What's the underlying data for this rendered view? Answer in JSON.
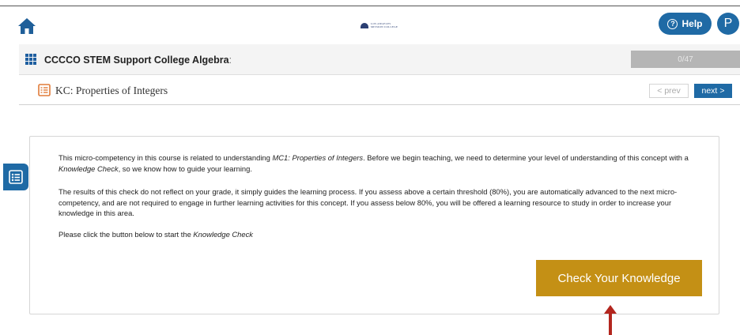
{
  "header": {
    "logo_lines": [
      "LOS ANGELES",
      "MISSION COLLEGE"
    ],
    "help_label": "Help",
    "help_glyph": "?",
    "avatar_initial": "P",
    "accent_color": "#1f6aa5"
  },
  "course": {
    "title": "CCCCO STEM Support College Algebra",
    "title_suffix": ":",
    "progress": "0/47"
  },
  "lesson": {
    "title": "KC: Properties of Integers",
    "prev_label": "prev",
    "next_label": "next"
  },
  "content": {
    "p1": {
      "a": "This micro-competency in this course is related to understanding ",
      "b": "MC1: Properties of Integers",
      "c": ". Before we begin teaching, we need to determine your level of understanding of this concept with a ",
      "d": "Knowledge Check",
      "e": ", so we know how to guide your learning."
    },
    "p2": "The results of this check do not reflect on your grade, it simply guides the learning process. If you assess above a certain threshold (80%), you are automatically advanced to the next micro-competency, and are not required to engage in further learning activities for this concept. If you assess below 80%, you will be offered a learning resource to study in order to increase your knowledge in this area.",
    "p3": {
      "a": "Please click the button below to start the ",
      "b": "Knowledge Check"
    },
    "button_label": "Check Your Knowledge",
    "button_color": "#c49015"
  },
  "annotation": {
    "arrow_color": "#b3261e"
  }
}
